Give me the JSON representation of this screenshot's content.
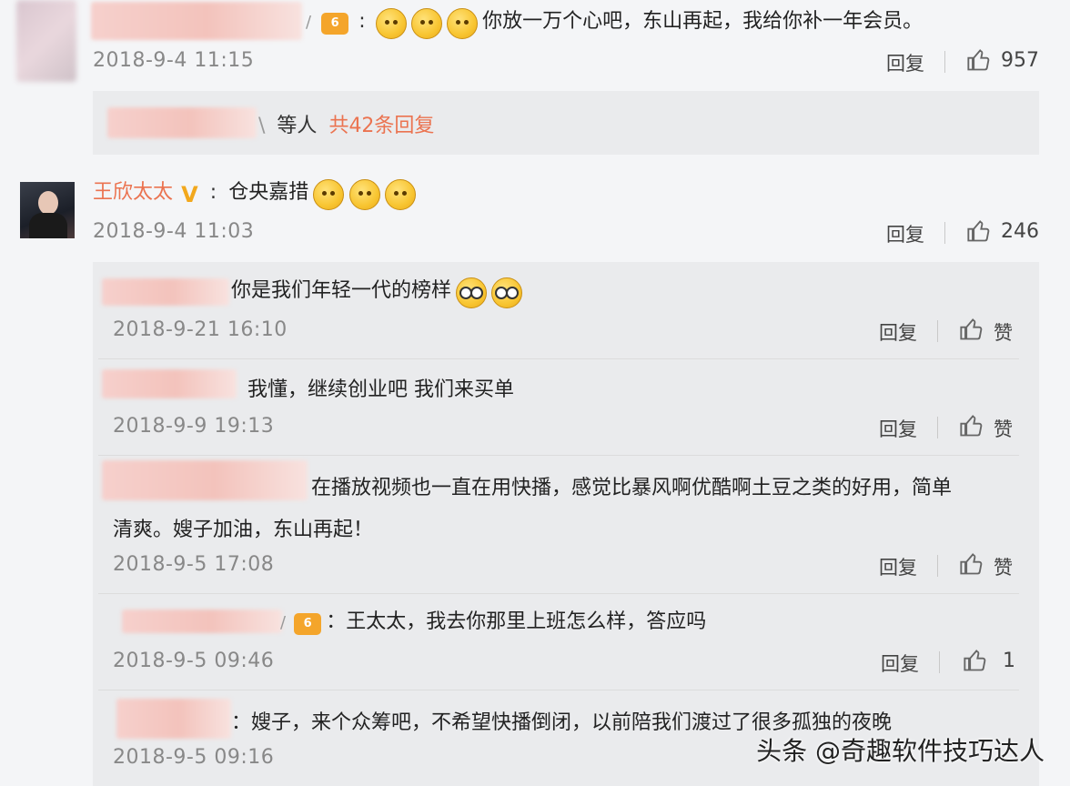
{
  "comments": [
    {
      "text": "你放一万个心吧，东山再起，我给你补一年会员。",
      "time": "2018-9-4 11:15",
      "reply_label": "回复",
      "likes": "957",
      "replies_summary": {
        "mid_text": "等人",
        "link_text": "共42条回复"
      }
    },
    {
      "author": "王欣太太",
      "text": "仓央嘉措",
      "time": "2018-9-4 11:03",
      "reply_label": "回复",
      "likes": "246"
    }
  ],
  "replies": [
    {
      "text": "你是我们年轻一代的榜样",
      "time": "2018-9-21 16:10",
      "reply_label": "回复",
      "like_label": "赞"
    },
    {
      "text": "我懂，继续创业吧 我们来买单",
      "time": "2018-9-9 19:13",
      "reply_label": "回复",
      "like_label": "赞"
    },
    {
      "text_line1": "在播放视频也一直在用快播，感觉比暴风啊优酷啊土豆之类的好用，简单",
      "text_line2": "清爽。嫂子加油，东山再起！",
      "time": "2018-9-5 17:08",
      "reply_label": "回复",
      "like_label": "赞"
    },
    {
      "text": "：王太太，我去你那里上班怎么样，答应吗",
      "time": "2018-9-5 09:46",
      "reply_label": "回复",
      "like_label": "1"
    },
    {
      "text": "：嫂子，来个众筹吧，不希望快播倒闭，以前陪我们渡过了很多孤独的夜晚",
      "time": "2018-9-5 09:16"
    }
  ],
  "watermark": "头条 @奇趣软件技巧达人",
  "colors": {
    "link": "#eb7350",
    "author": "#eb7350",
    "vip": "#f4a52b",
    "background": "#f4f5f7",
    "panel": "#eaebed"
  }
}
